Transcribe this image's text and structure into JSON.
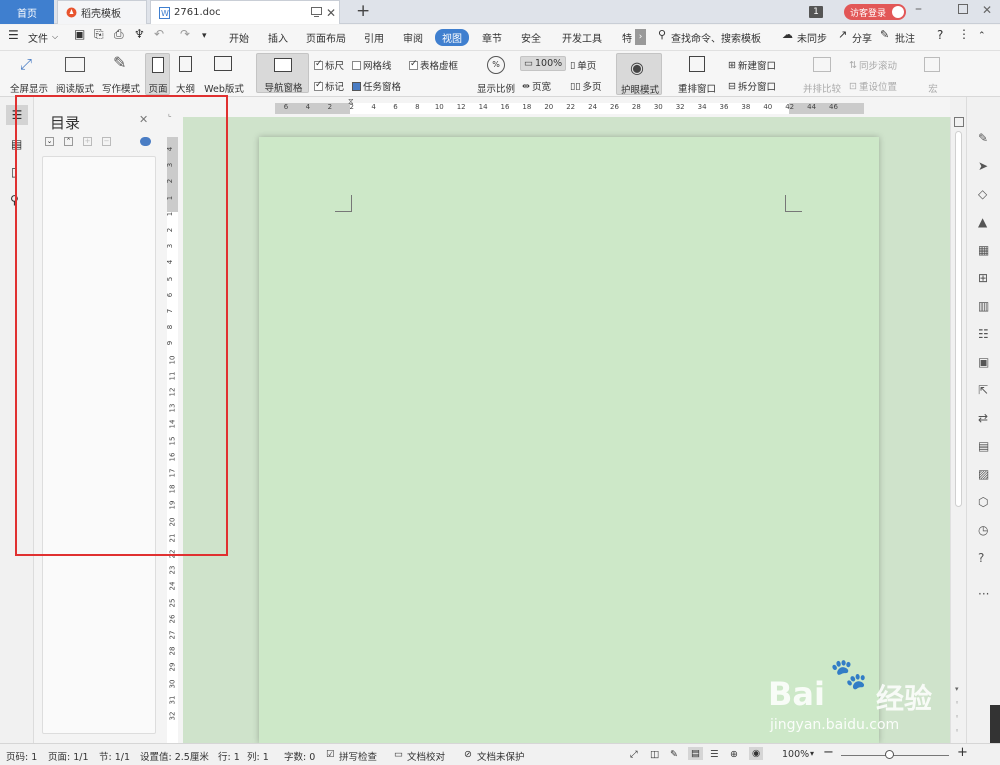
{
  "tabs": {
    "home": "首页",
    "templates": "稻壳模板",
    "doc": "2761.doc",
    "badge": "1",
    "login": "访客登录"
  },
  "menu": {
    "file": "文件",
    "items": [
      "开始",
      "插入",
      "页面布局",
      "引用",
      "审阅",
      "视图",
      "章节",
      "安全",
      "开发工具",
      "特"
    ],
    "active": "视图",
    "search": "查找命令、搜索模板",
    "sync": "未同步",
    "share": "分享",
    "comment": "批注",
    "help": "?"
  },
  "toolbar": {
    "fullscreen": "全屏显示",
    "reading": "阅读版式",
    "writing": "写作模式",
    "page": "页面",
    "outline": "大纲",
    "web": "Web版式",
    "navpane": "导航窗格",
    "ruler": "标尺",
    "gridlines": "网格线",
    "table_dashed": "表格虚框",
    "marks": "标记",
    "task_pane": "任务窗格",
    "zoom_label": "显示比例",
    "zoom_100": "100%",
    "single": "单页",
    "page_width": "页宽",
    "multi": "多页",
    "eye": "护眼模式",
    "rearrange": "重排窗口",
    "new_window": "新建窗口",
    "split": "拆分窗口",
    "side_by_side": "并排比较",
    "sync_scroll": "同步滚动",
    "reset_pos": "重设位置",
    "macro": "宏"
  },
  "nav": {
    "title": "目录"
  },
  "ruler": {
    "h_ticks": [
      "6",
      "4",
      "2",
      "2",
      "4",
      "6",
      "8",
      "10",
      "12",
      "14",
      "16",
      "18",
      "20",
      "22",
      "24",
      "26",
      "28",
      "30",
      "32",
      "34",
      "36",
      "38",
      "40",
      "42",
      "44",
      "46"
    ],
    "v_ticks": [
      "4",
      "3",
      "2",
      "1",
      "1",
      "2",
      "3",
      "4",
      "5",
      "6",
      "7",
      "8",
      "9",
      "10",
      "11",
      "12",
      "13",
      "14",
      "15",
      "16",
      "17",
      "18",
      "19",
      "20",
      "21",
      "22",
      "23",
      "24",
      "25",
      "26",
      "27",
      "28",
      "29",
      "30",
      "31",
      "32"
    ]
  },
  "status": {
    "page_no": "页码: 1",
    "pages": "页面: 1/1",
    "section": "节: 1/1",
    "setting": "设置值: 2.5厘米",
    "row": "行: 1",
    "col": "列: 1",
    "words": "字数: 0",
    "spell": "拼写检查",
    "proof": "文档校对",
    "protect": "文档未保护",
    "zoom": "100%",
    "zoom_fraction": 0.45
  },
  "watermark": {
    "brand": "Bai",
    "brand2": "经验",
    "url": "jingyan.baidu.com"
  },
  "colors": {
    "accent": "#3f7fcf",
    "highlight": "#e03030",
    "page": "#cde8c8",
    "login": "#e25757"
  }
}
